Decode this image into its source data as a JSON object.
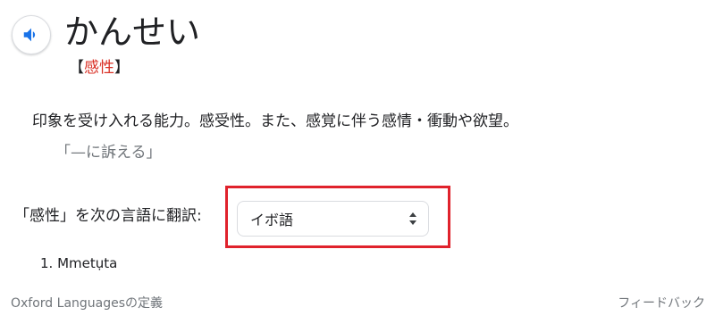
{
  "entry": {
    "headword": "かんせい",
    "kanji_bracket_open": "【",
    "kanji": "感性",
    "kanji_bracket_close": "】",
    "definition": "印象を受け入れる能力。感受性。また、感覚に伴う感情・衝動や欲望。",
    "example": "「—に訴える」"
  },
  "translate": {
    "label": "「感性」を次の言語に翻訳:",
    "selected_language": "イボ語",
    "results": [
      {
        "number": "1.",
        "text": "Mmetụta"
      }
    ]
  },
  "footer": {
    "source": "Oxford Languagesの定義",
    "feedback": "フィードバック"
  },
  "icons": {
    "audio": "speaker-icon",
    "select": "sort-arrows-icon"
  },
  "colors": {
    "accent_blue": "#1a73e8",
    "kanji_red": "#d93025",
    "highlight_red": "#e0222c",
    "muted_text": "#70757a"
  }
}
